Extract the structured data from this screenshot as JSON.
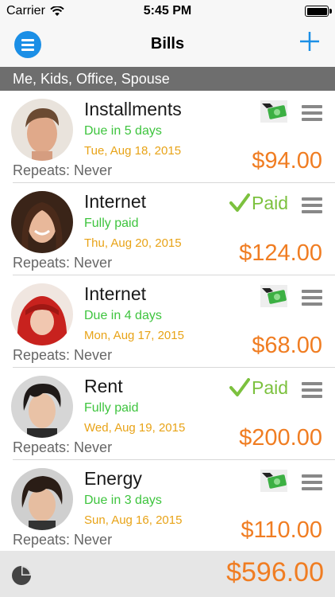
{
  "status_bar": {
    "carrier": "Carrier",
    "time": "5:45 PM"
  },
  "nav": {
    "title": "Bills"
  },
  "filter": {
    "label": "Me, Kids, Office, Spouse"
  },
  "bills": [
    {
      "name": "Installments",
      "status": "Due in 5 days",
      "date": "Tue, Aug 18, 2015",
      "repeats": "Repeats: Never",
      "amount": "$94.00",
      "paid": false
    },
    {
      "name": "Internet",
      "status": "Fully paid",
      "date": "Thu, Aug 20, 2015",
      "repeats": "Repeats: Never",
      "amount": "$124.00",
      "paid": true,
      "paid_label": "Paid"
    },
    {
      "name": "Internet",
      "status": "Due in 4 days",
      "date": "Mon, Aug 17, 2015",
      "repeats": "Repeats: Never",
      "amount": "$68.00",
      "paid": false
    },
    {
      "name": "Rent",
      "status": "Fully paid",
      "date": "Wed, Aug 19, 2015",
      "repeats": "Repeats: Never",
      "amount": "$200.00",
      "paid": true,
      "paid_label": "Paid"
    },
    {
      "name": "Energy",
      "status": "Due in 3 days",
      "date": "Sun, Aug 16, 2015",
      "repeats": "Repeats: Never",
      "amount": "$110.00",
      "paid": false
    }
  ],
  "footer": {
    "total": "$596.00"
  },
  "colors": {
    "accent": "#1b8fe6",
    "amount": "#f07d22",
    "status_green": "#3ec43e",
    "date_orange": "#e8a317",
    "paid_green": "#7cc13e",
    "filter_bar": "#6e6e6e"
  },
  "icons": {
    "menu": "menu-icon",
    "add": "plus-icon",
    "pay": "money-hand-icon",
    "paid": "checkmark-icon",
    "handle": "reorder-handle-icon",
    "chart": "pie-chart-icon",
    "wifi": "wifi-icon",
    "battery": "battery-icon"
  }
}
